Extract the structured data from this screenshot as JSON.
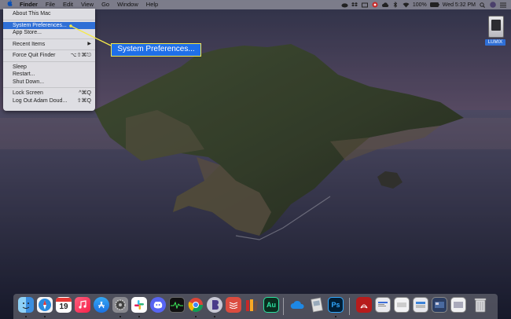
{
  "menubar": {
    "apple": "",
    "app_name": "Finder",
    "menus": [
      "File",
      "Edit",
      "View",
      "Go",
      "Window",
      "Help"
    ],
    "battery": "100%",
    "clock": "Wed 5:32 PM",
    "status_icons": [
      "dropbox-icon",
      "box-icon",
      "creative-cloud-icon",
      "sync-icon",
      "bluetooth-icon",
      "wifi-icon",
      "battery-icon",
      "search-icon",
      "avatar",
      "notification-center-icon"
    ]
  },
  "apple_menu": {
    "about": "About This Mac",
    "system_prefs": "System Preferences...",
    "app_store": "App Store...",
    "recent_items": "Recent Items",
    "recent_arrow": "▶",
    "force_quit": "Force Quit Finder",
    "force_quit_shortcut": "⌥⇧⌘⎋",
    "sleep": "Sleep",
    "restart": "Restart...",
    "shutdown": "Shut Down...",
    "lock_screen": "Lock Screen",
    "lock_shortcut": "^⌘Q",
    "log_out": "Log Out Adam Doud...",
    "log_out_shortcut": "⇧⌘Q"
  },
  "callout": {
    "text": "System Preferences..."
  },
  "desktop": {
    "drive_label": "LUMIX"
  },
  "dock": {
    "calendar_day": "19",
    "apps": [
      "finder",
      "safari",
      "calendar",
      "music",
      "app-store",
      "system-preferences",
      "slack",
      "discord",
      "activity-monitor",
      "chrome",
      "bbedit",
      "todoist",
      "books",
      "audition",
      "onedrive",
      "preview",
      "photoshop",
      "acrobat",
      "document",
      "document",
      "document",
      "document",
      "document",
      "trash"
    ],
    "au_label": "Au",
    "ps_label": "Ps"
  }
}
